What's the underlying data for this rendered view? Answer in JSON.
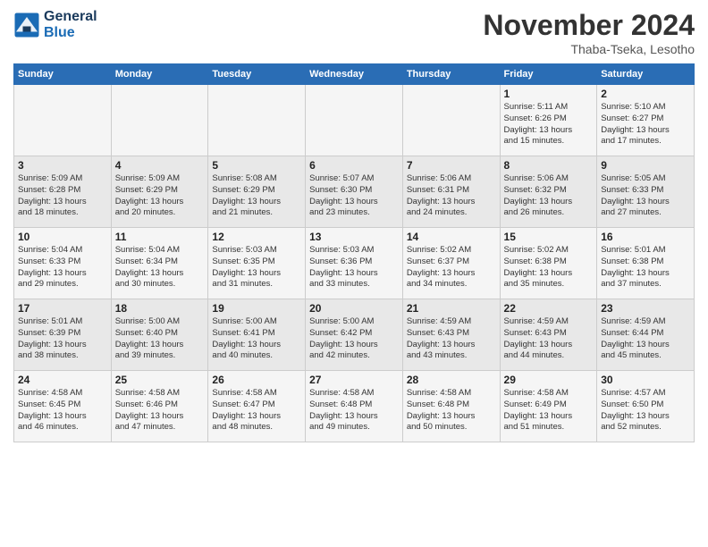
{
  "logo": {
    "line1": "General",
    "line2": "Blue"
  },
  "title": "November 2024",
  "subtitle": "Thaba-Tseka, Lesotho",
  "days_of_week": [
    "Sunday",
    "Monday",
    "Tuesday",
    "Wednesday",
    "Thursday",
    "Friday",
    "Saturday"
  ],
  "weeks": [
    [
      {
        "day": "",
        "info": ""
      },
      {
        "day": "",
        "info": ""
      },
      {
        "day": "",
        "info": ""
      },
      {
        "day": "",
        "info": ""
      },
      {
        "day": "",
        "info": ""
      },
      {
        "day": "1",
        "info": "Sunrise: 5:11 AM\nSunset: 6:26 PM\nDaylight: 13 hours\nand 15 minutes."
      },
      {
        "day": "2",
        "info": "Sunrise: 5:10 AM\nSunset: 6:27 PM\nDaylight: 13 hours\nand 17 minutes."
      }
    ],
    [
      {
        "day": "3",
        "info": "Sunrise: 5:09 AM\nSunset: 6:28 PM\nDaylight: 13 hours\nand 18 minutes."
      },
      {
        "day": "4",
        "info": "Sunrise: 5:09 AM\nSunset: 6:29 PM\nDaylight: 13 hours\nand 20 minutes."
      },
      {
        "day": "5",
        "info": "Sunrise: 5:08 AM\nSunset: 6:29 PM\nDaylight: 13 hours\nand 21 minutes."
      },
      {
        "day": "6",
        "info": "Sunrise: 5:07 AM\nSunset: 6:30 PM\nDaylight: 13 hours\nand 23 minutes."
      },
      {
        "day": "7",
        "info": "Sunrise: 5:06 AM\nSunset: 6:31 PM\nDaylight: 13 hours\nand 24 minutes."
      },
      {
        "day": "8",
        "info": "Sunrise: 5:06 AM\nSunset: 6:32 PM\nDaylight: 13 hours\nand 26 minutes."
      },
      {
        "day": "9",
        "info": "Sunrise: 5:05 AM\nSunset: 6:33 PM\nDaylight: 13 hours\nand 27 minutes."
      }
    ],
    [
      {
        "day": "10",
        "info": "Sunrise: 5:04 AM\nSunset: 6:33 PM\nDaylight: 13 hours\nand 29 minutes."
      },
      {
        "day": "11",
        "info": "Sunrise: 5:04 AM\nSunset: 6:34 PM\nDaylight: 13 hours\nand 30 minutes."
      },
      {
        "day": "12",
        "info": "Sunrise: 5:03 AM\nSunset: 6:35 PM\nDaylight: 13 hours\nand 31 minutes."
      },
      {
        "day": "13",
        "info": "Sunrise: 5:03 AM\nSunset: 6:36 PM\nDaylight: 13 hours\nand 33 minutes."
      },
      {
        "day": "14",
        "info": "Sunrise: 5:02 AM\nSunset: 6:37 PM\nDaylight: 13 hours\nand 34 minutes."
      },
      {
        "day": "15",
        "info": "Sunrise: 5:02 AM\nSunset: 6:38 PM\nDaylight: 13 hours\nand 35 minutes."
      },
      {
        "day": "16",
        "info": "Sunrise: 5:01 AM\nSunset: 6:38 PM\nDaylight: 13 hours\nand 37 minutes."
      }
    ],
    [
      {
        "day": "17",
        "info": "Sunrise: 5:01 AM\nSunset: 6:39 PM\nDaylight: 13 hours\nand 38 minutes."
      },
      {
        "day": "18",
        "info": "Sunrise: 5:00 AM\nSunset: 6:40 PM\nDaylight: 13 hours\nand 39 minutes."
      },
      {
        "day": "19",
        "info": "Sunrise: 5:00 AM\nSunset: 6:41 PM\nDaylight: 13 hours\nand 40 minutes."
      },
      {
        "day": "20",
        "info": "Sunrise: 5:00 AM\nSunset: 6:42 PM\nDaylight: 13 hours\nand 42 minutes."
      },
      {
        "day": "21",
        "info": "Sunrise: 4:59 AM\nSunset: 6:43 PM\nDaylight: 13 hours\nand 43 minutes."
      },
      {
        "day": "22",
        "info": "Sunrise: 4:59 AM\nSunset: 6:43 PM\nDaylight: 13 hours\nand 44 minutes."
      },
      {
        "day": "23",
        "info": "Sunrise: 4:59 AM\nSunset: 6:44 PM\nDaylight: 13 hours\nand 45 minutes."
      }
    ],
    [
      {
        "day": "24",
        "info": "Sunrise: 4:58 AM\nSunset: 6:45 PM\nDaylight: 13 hours\nand 46 minutes."
      },
      {
        "day": "25",
        "info": "Sunrise: 4:58 AM\nSunset: 6:46 PM\nDaylight: 13 hours\nand 47 minutes."
      },
      {
        "day": "26",
        "info": "Sunrise: 4:58 AM\nSunset: 6:47 PM\nDaylight: 13 hours\nand 48 minutes."
      },
      {
        "day": "27",
        "info": "Sunrise: 4:58 AM\nSunset: 6:48 PM\nDaylight: 13 hours\nand 49 minutes."
      },
      {
        "day": "28",
        "info": "Sunrise: 4:58 AM\nSunset: 6:48 PM\nDaylight: 13 hours\nand 50 minutes."
      },
      {
        "day": "29",
        "info": "Sunrise: 4:58 AM\nSunset: 6:49 PM\nDaylight: 13 hours\nand 51 minutes."
      },
      {
        "day": "30",
        "info": "Sunrise: 4:57 AM\nSunset: 6:50 PM\nDaylight: 13 hours\nand 52 minutes."
      }
    ]
  ]
}
